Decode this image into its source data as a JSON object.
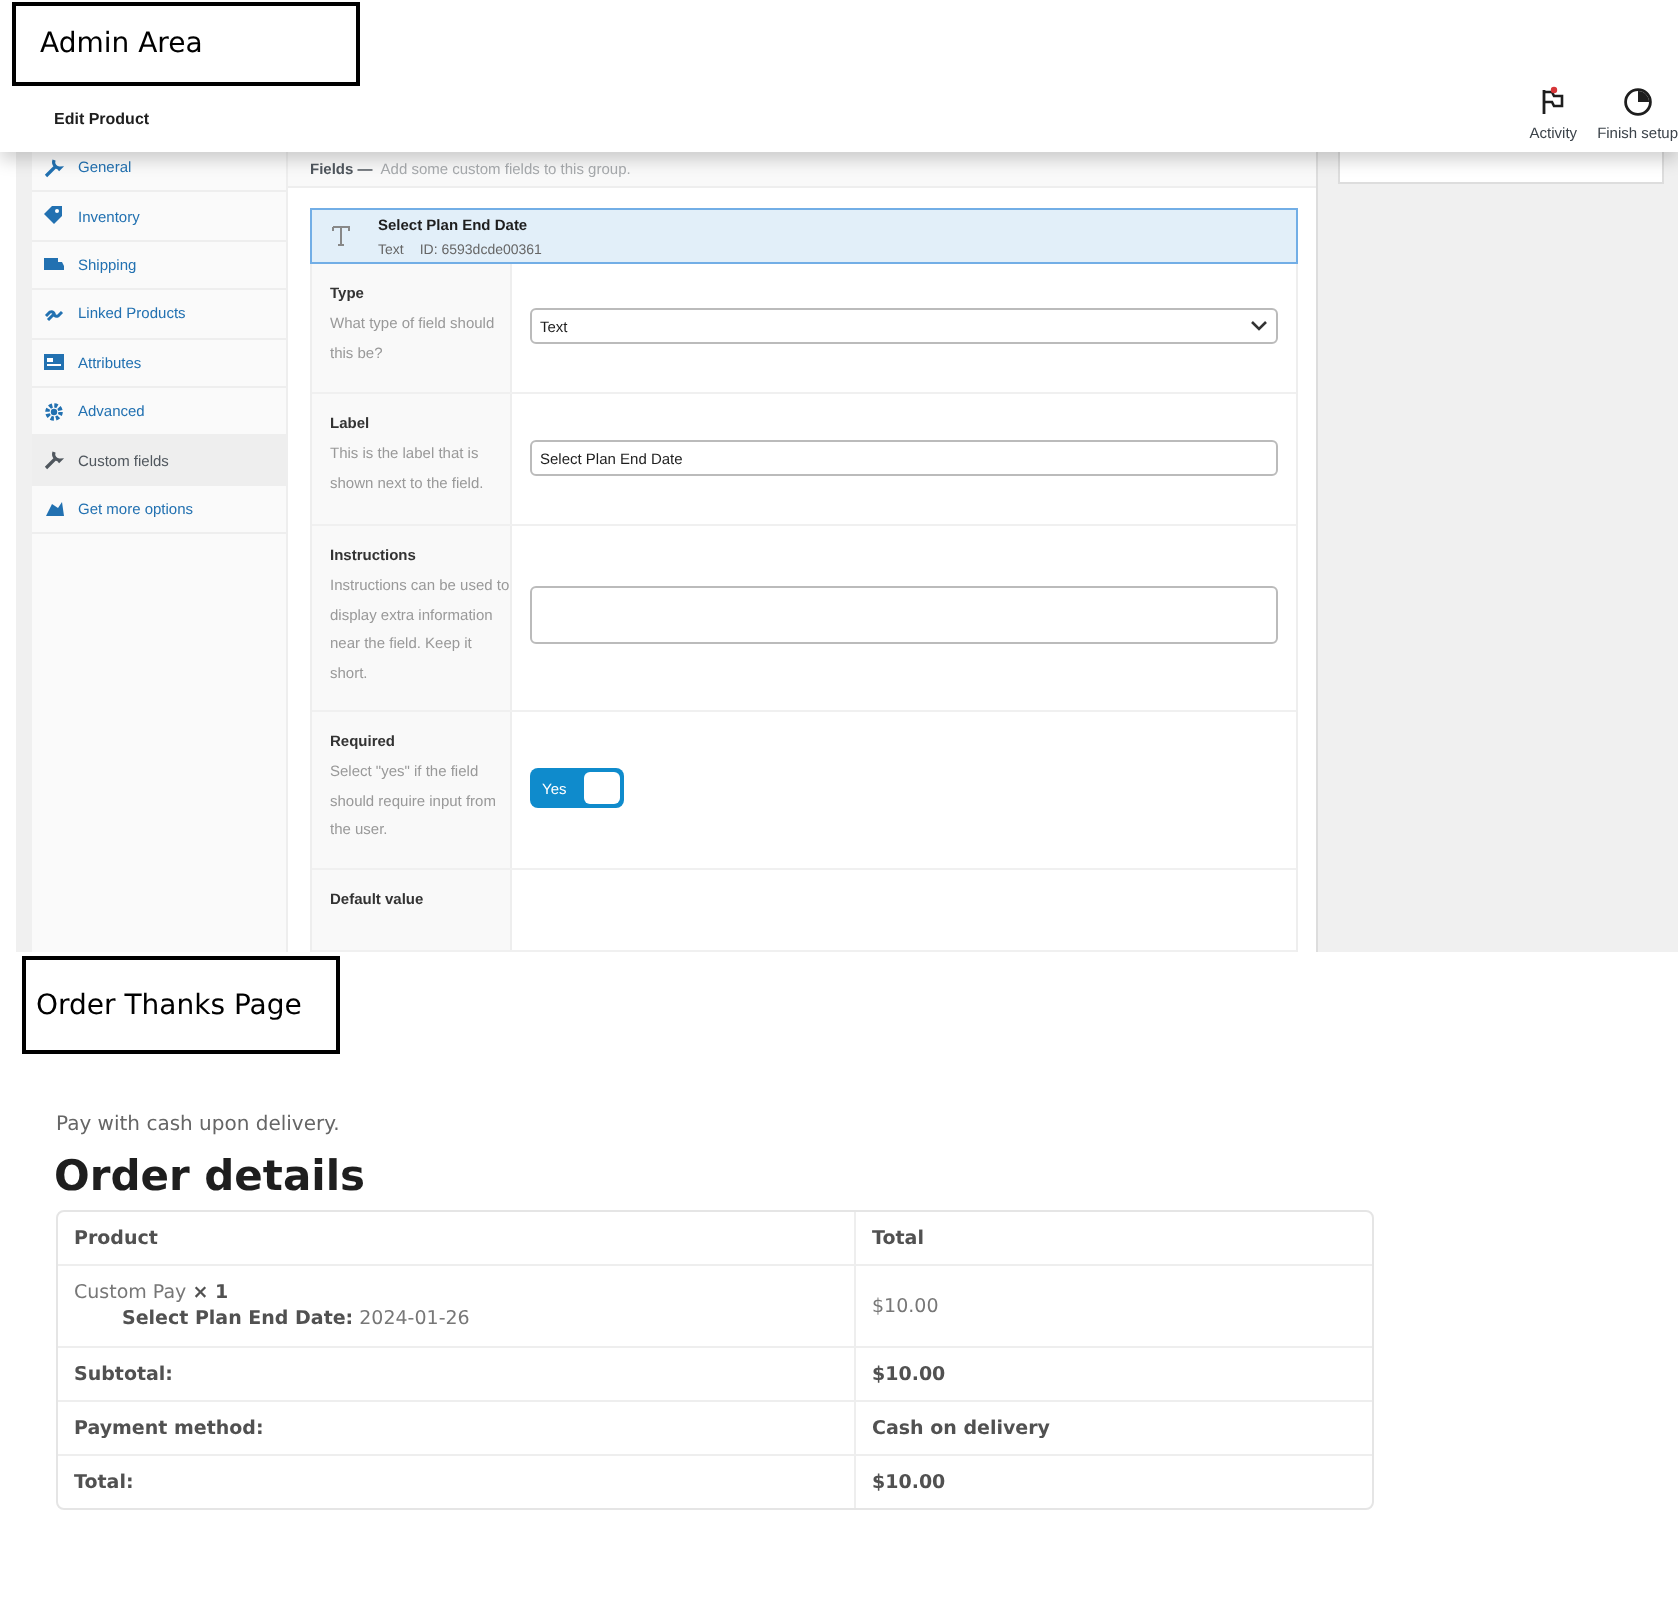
{
  "admin_area": {
    "caption": "Admin Area",
    "header": {
      "title": "Edit Product",
      "actions": [
        {
          "label": "Activity"
        },
        {
          "label": "Finish setup"
        }
      ]
    },
    "tabs": [
      {
        "label": "General",
        "selected": false
      },
      {
        "label": "Inventory",
        "selected": false
      },
      {
        "label": "Shipping",
        "selected": false
      },
      {
        "label": "Linked Products",
        "selected": false
      },
      {
        "label": "Attributes",
        "selected": false
      },
      {
        "label": "Advanced",
        "selected": false
      },
      {
        "label": "Custom fields",
        "selected": true
      },
      {
        "label": "Get more options",
        "selected": false
      }
    ],
    "fields_title": "Fields —",
    "fields_hint": "Add some custom fields to this group.",
    "field": {
      "name": "Select Plan End Date",
      "type": "Text",
      "id": "ID: 6593dcde00361"
    },
    "settings": [
      {
        "kind": "select",
        "label": "Type",
        "hint": "What type of field should this be?",
        "value": "Text"
      },
      {
        "kind": "text",
        "label": "Label",
        "hint": "This is the label that is shown next to the field.",
        "value": "Select Plan End Date"
      },
      {
        "kind": "textarea",
        "label": "Instructions",
        "hint": "Instructions can be used to display extra information near the field. Keep it short."
      },
      {
        "kind": "toggle",
        "label": "Required",
        "hint": "Select \"yes\" if the field should require input from the user.",
        "toggle_label": "Yes",
        "on": true
      },
      {
        "kind": "cut",
        "label": "Default value"
      }
    ]
  },
  "order_page": {
    "caption": "Order Thanks Page",
    "payment_note": "Pay with cash upon delivery.",
    "heading": "Order details",
    "table": {
      "columns": [
        "Product",
        "Total"
      ],
      "rows": [
        {
          "kind": "item",
          "product": "Custom Pay **× 1**",
          "meta": "**Select Plan End Date:** 2024-01-26",
          "total": "$10.00"
        },
        {
          "kind": "summary",
          "label": "Subtotal:",
          "value": "$10.00"
        },
        {
          "kind": "summary",
          "label": "Payment method:",
          "value": "Cash on delivery"
        },
        {
          "kind": "summary",
          "label": "Total:",
          "value": "$10.00"
        }
      ]
    }
  }
}
